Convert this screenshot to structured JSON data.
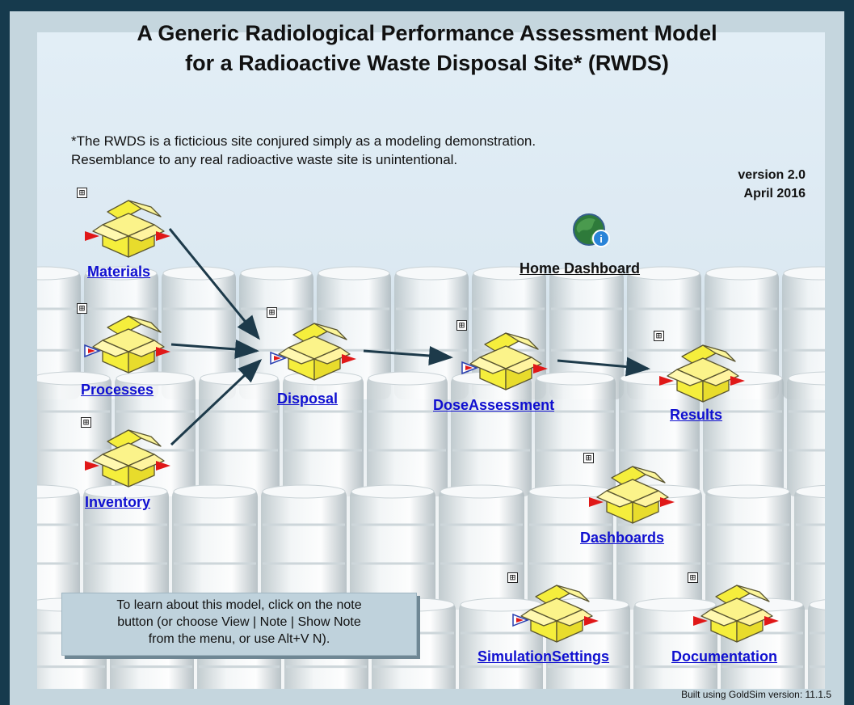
{
  "title": {
    "line1": "A Generic Radiological Performance Assessment Model",
    "line2": "for a Radioactive Waste Disposal Site* (RWDS)"
  },
  "disclaimer": {
    "line1": "*The RWDS is a ficticious site conjured simply as a modeling demonstration.",
    "line2": "Resemblance to any real radioactive waste site is unintentional."
  },
  "version": {
    "number": "version 2.0",
    "date": "April 2016"
  },
  "home_dashboard": {
    "label": "Home Dashboard",
    "icon": "globe-info-icon"
  },
  "containers": {
    "materials": "Materials",
    "processes": "Processes",
    "inventory": "Inventory",
    "disposal": "Disposal",
    "dose_assessment": "DoseAssessment",
    "results": "Results",
    "dashboards": "Dashboards",
    "simulation_settings": "SimulationSettings",
    "documentation": "Documentation"
  },
  "expander_symbol": "⊞",
  "note": {
    "line1": "To learn about this model, click on the note",
    "line2": "button (or choose View | Note | Show Note",
    "line3": "from the menu, or use Alt+V N)."
  },
  "footer": {
    "built_using": "Built using GoldSim version: 11.1.5"
  },
  "colors": {
    "link": "#1010d0",
    "box_fill": "#f5ee3c",
    "arrow": "#1d3a4a",
    "port_red": "#e01818",
    "background_frame": "#163a4d"
  }
}
